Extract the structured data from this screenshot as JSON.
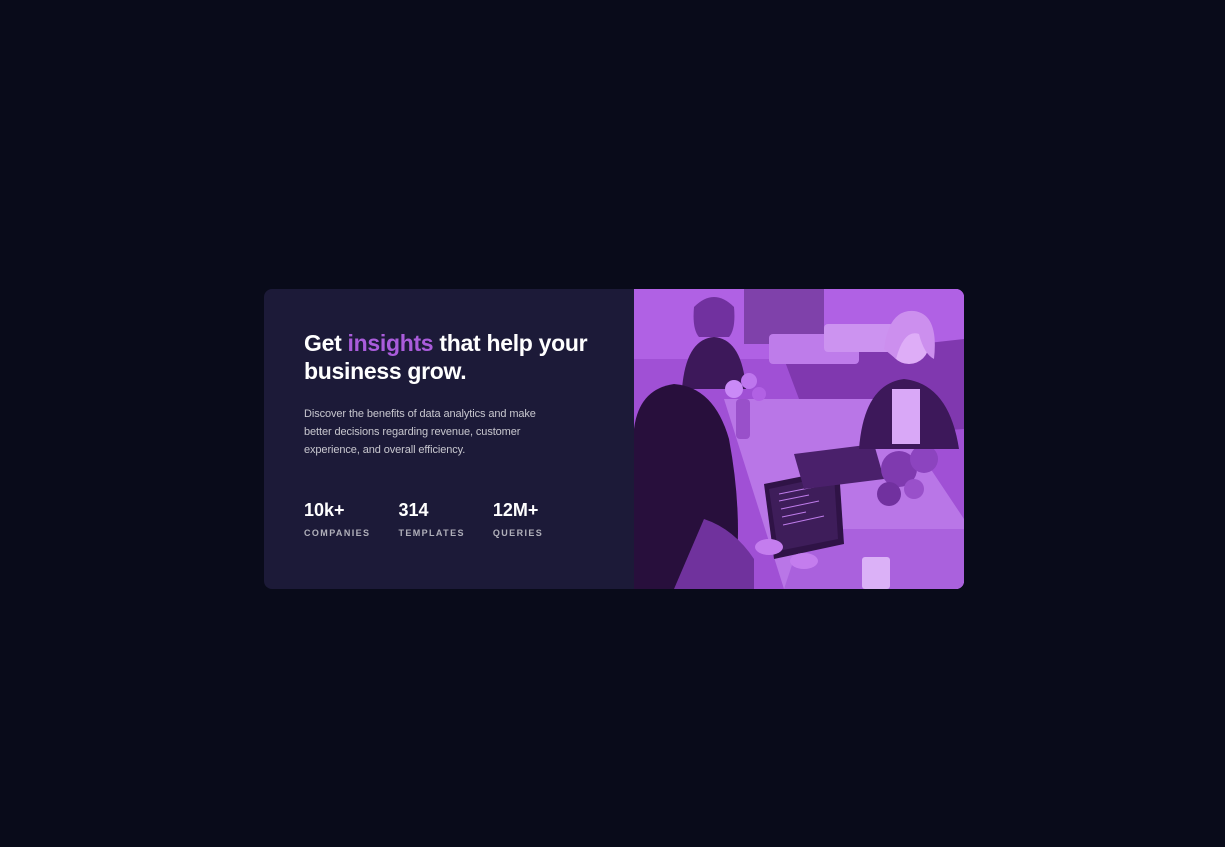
{
  "hero": {
    "title_part1": "Get ",
    "title_accent": "insights",
    "title_part2": " that help your business grow.",
    "description": "Discover the benefits of data analytics and make better decisions regarding revenue, customer experience, and overall efficiency."
  },
  "stats": [
    {
      "value": "10k+",
      "label": "Companies"
    },
    {
      "value": "314",
      "label": "Templates"
    },
    {
      "value": "12M+",
      "label": "Queries"
    }
  ],
  "colors": {
    "page_background": "#090b1a",
    "card_background": "#1c1a38",
    "accent": "#aa5cdb",
    "image_tint": "#9448c7"
  }
}
